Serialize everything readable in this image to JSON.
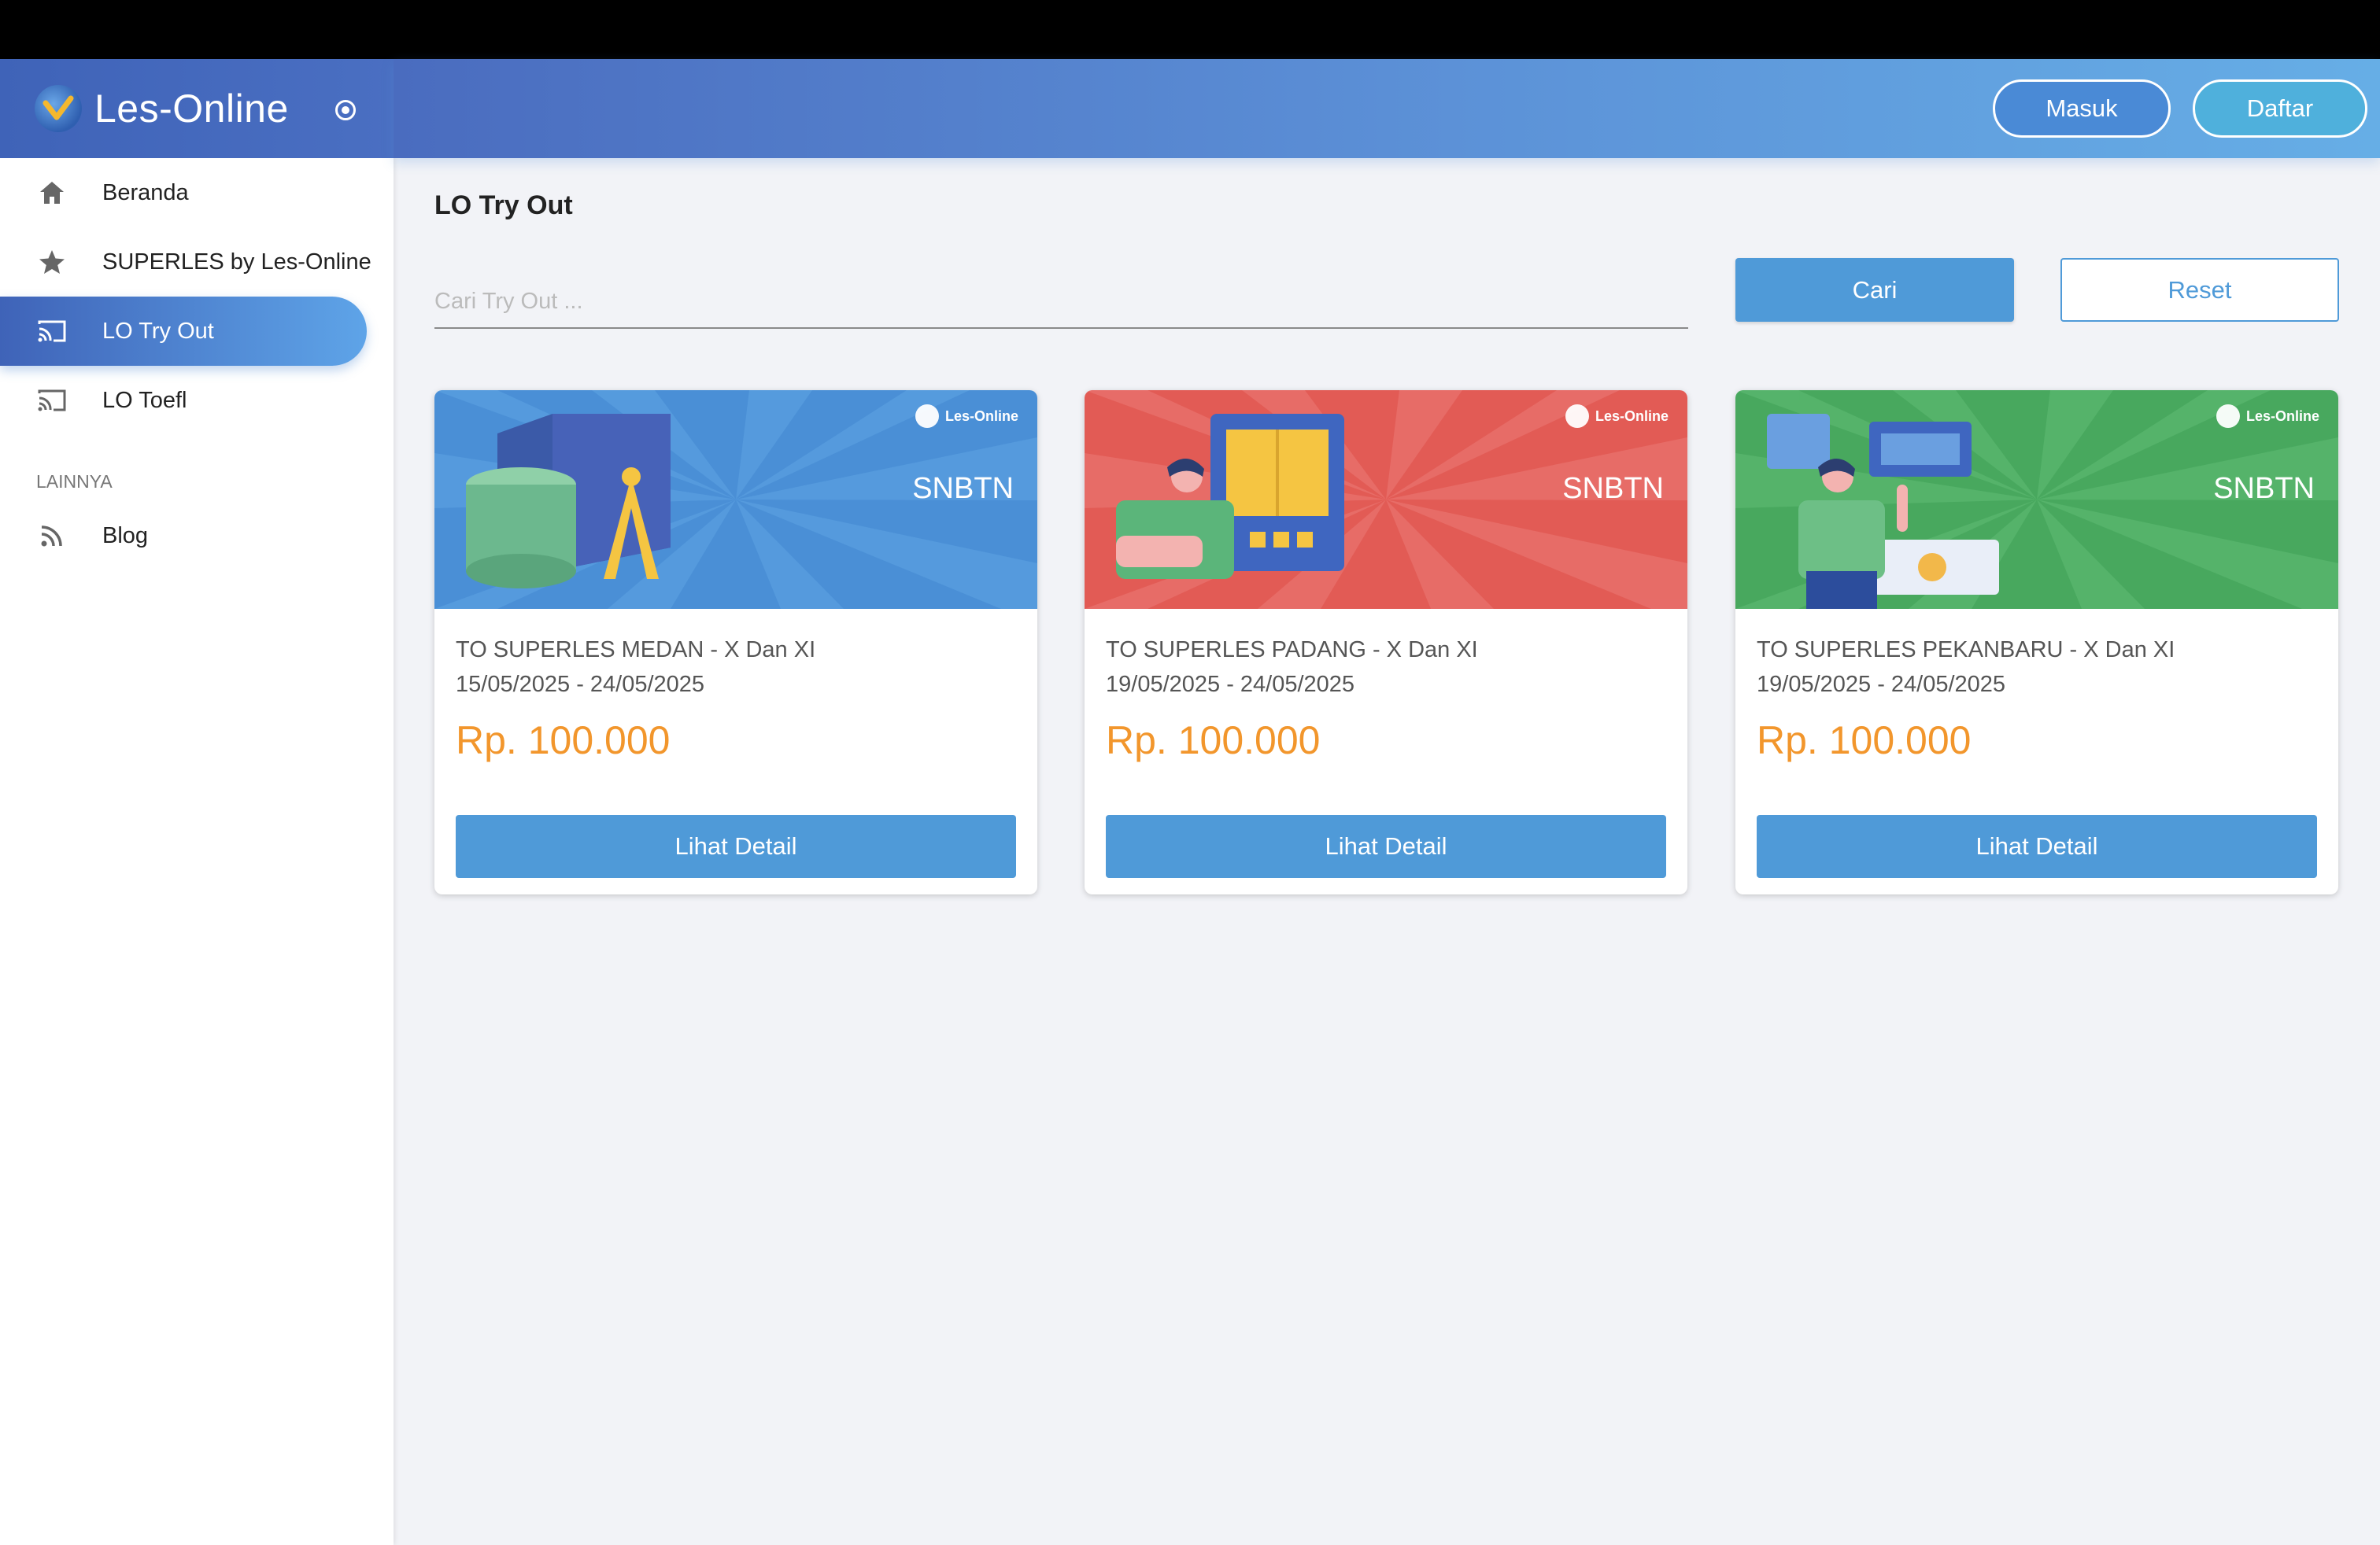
{
  "app": {
    "name": "Les-Online"
  },
  "sidebar": {
    "items": [
      {
        "label": "Beranda",
        "icon": "home-icon"
      },
      {
        "label": "SUPERLES by Les-Online",
        "icon": "star-icon"
      },
      {
        "label": "LO Try Out",
        "icon": "cast-icon",
        "active": true
      },
      {
        "label": "LO Toefl",
        "icon": "cast-icon"
      }
    ],
    "section_label": "LAINNYA",
    "extra_items": [
      {
        "label": "Blog",
        "icon": "rss-icon"
      }
    ]
  },
  "header": {
    "login_label": "Masuk",
    "register_label": "Daftar"
  },
  "main": {
    "title": "LO Try Out",
    "search": {
      "placeholder": "Cari Try Out ...",
      "value": ""
    },
    "search_button": "Cari",
    "reset_button": "Reset",
    "cards": [
      {
        "brand": "Les-Online",
        "tag": "SNBTN",
        "title": "TO SUPERLES MEDAN - X Dan XI",
        "date": "15/05/2025 - 24/05/2025",
        "price": "Rp. 100.000",
        "button": "Lihat Detail",
        "color": "#4a8fd6"
      },
      {
        "brand": "Les-Online",
        "tag": "SNBTN",
        "title": "TO SUPERLES PADANG - X Dan XI",
        "date": "19/05/2025 - 24/05/2025",
        "price": "Rp. 100.000",
        "button": "Lihat Detail",
        "color": "#e25b55"
      },
      {
        "brand": "Les-Online",
        "tag": "SNBTN",
        "title": "TO SUPERLES PEKANBARU - X Dan XI",
        "date": "19/05/2025 - 24/05/2025",
        "price": "Rp. 100.000",
        "button": "Lihat Detail",
        "color": "#48a85e"
      }
    ]
  },
  "colors": {
    "accent": "#4f9ad8",
    "price": "#f2962c",
    "header_start": "#4a6cbf",
    "header_end": "#66aee6"
  }
}
